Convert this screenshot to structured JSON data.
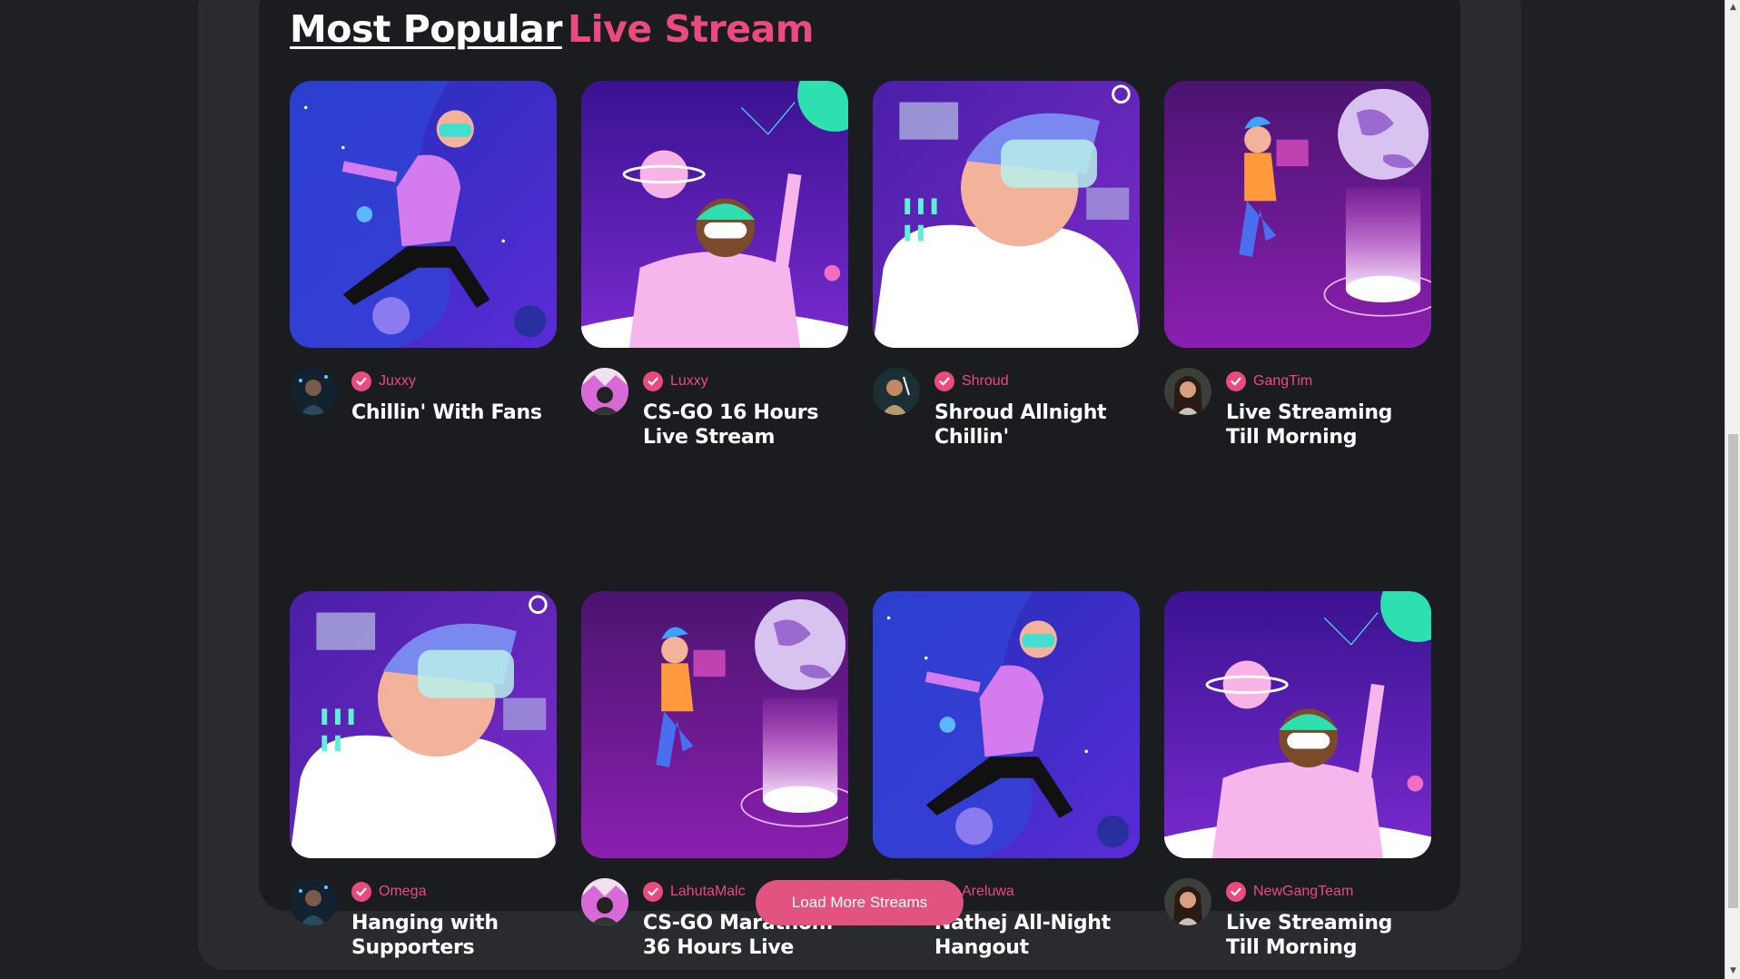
{
  "heading": {
    "part1": "Most Popular",
    "part2": "Live Stream"
  },
  "colors": {
    "accent": "#ea4b7e",
    "background": "#1f2023",
    "panel": "#1b1c1f"
  },
  "streams": [
    {
      "channel": "Juxxy",
      "title": "Chillin' With Fans",
      "thumb": "vr-floating-astronaut",
      "verified_icon": "check-badge-icon"
    },
    {
      "channel": "Luxxy",
      "title": "CS-GO 16 Hours Live Stream",
      "thumb": "vr-planet-dancer",
      "verified_icon": "check-badge-icon"
    },
    {
      "channel": "Shroud",
      "title": "Shroud Allnight Chillin'",
      "thumb": "vr-headset-closeup",
      "verified_icon": "check-badge-icon"
    },
    {
      "channel": "GangTim",
      "title": "Live Streaming Till Morning",
      "thumb": "vr-hologram-globe",
      "verified_icon": "check-badge-icon"
    },
    {
      "channel": "Omega",
      "title": "Hanging with Supporters",
      "thumb": "vr-headset-closeup",
      "verified_icon": "check-badge-icon"
    },
    {
      "channel": "LahutaMalc",
      "title": "CS-GO Marathon: 36 Hours Live",
      "thumb": "vr-hologram-globe",
      "verified_icon": "check-badge-icon"
    },
    {
      "channel": "Areluwa",
      "title": "Nathej All-Night Hangout",
      "thumb": "vr-floating-astronaut",
      "verified_icon": "check-badge-icon"
    },
    {
      "channel": "NewGangTeam",
      "title": "Live Streaming Till Morning",
      "thumb": "vr-planet-dancer",
      "verified_icon": "check-badge-icon"
    }
  ],
  "load_more": {
    "label": "Load More Streams"
  },
  "scrollbar": {
    "up_icon": "scroll-up-arrow-icon",
    "down_icon": "scroll-down-arrow-icon"
  }
}
